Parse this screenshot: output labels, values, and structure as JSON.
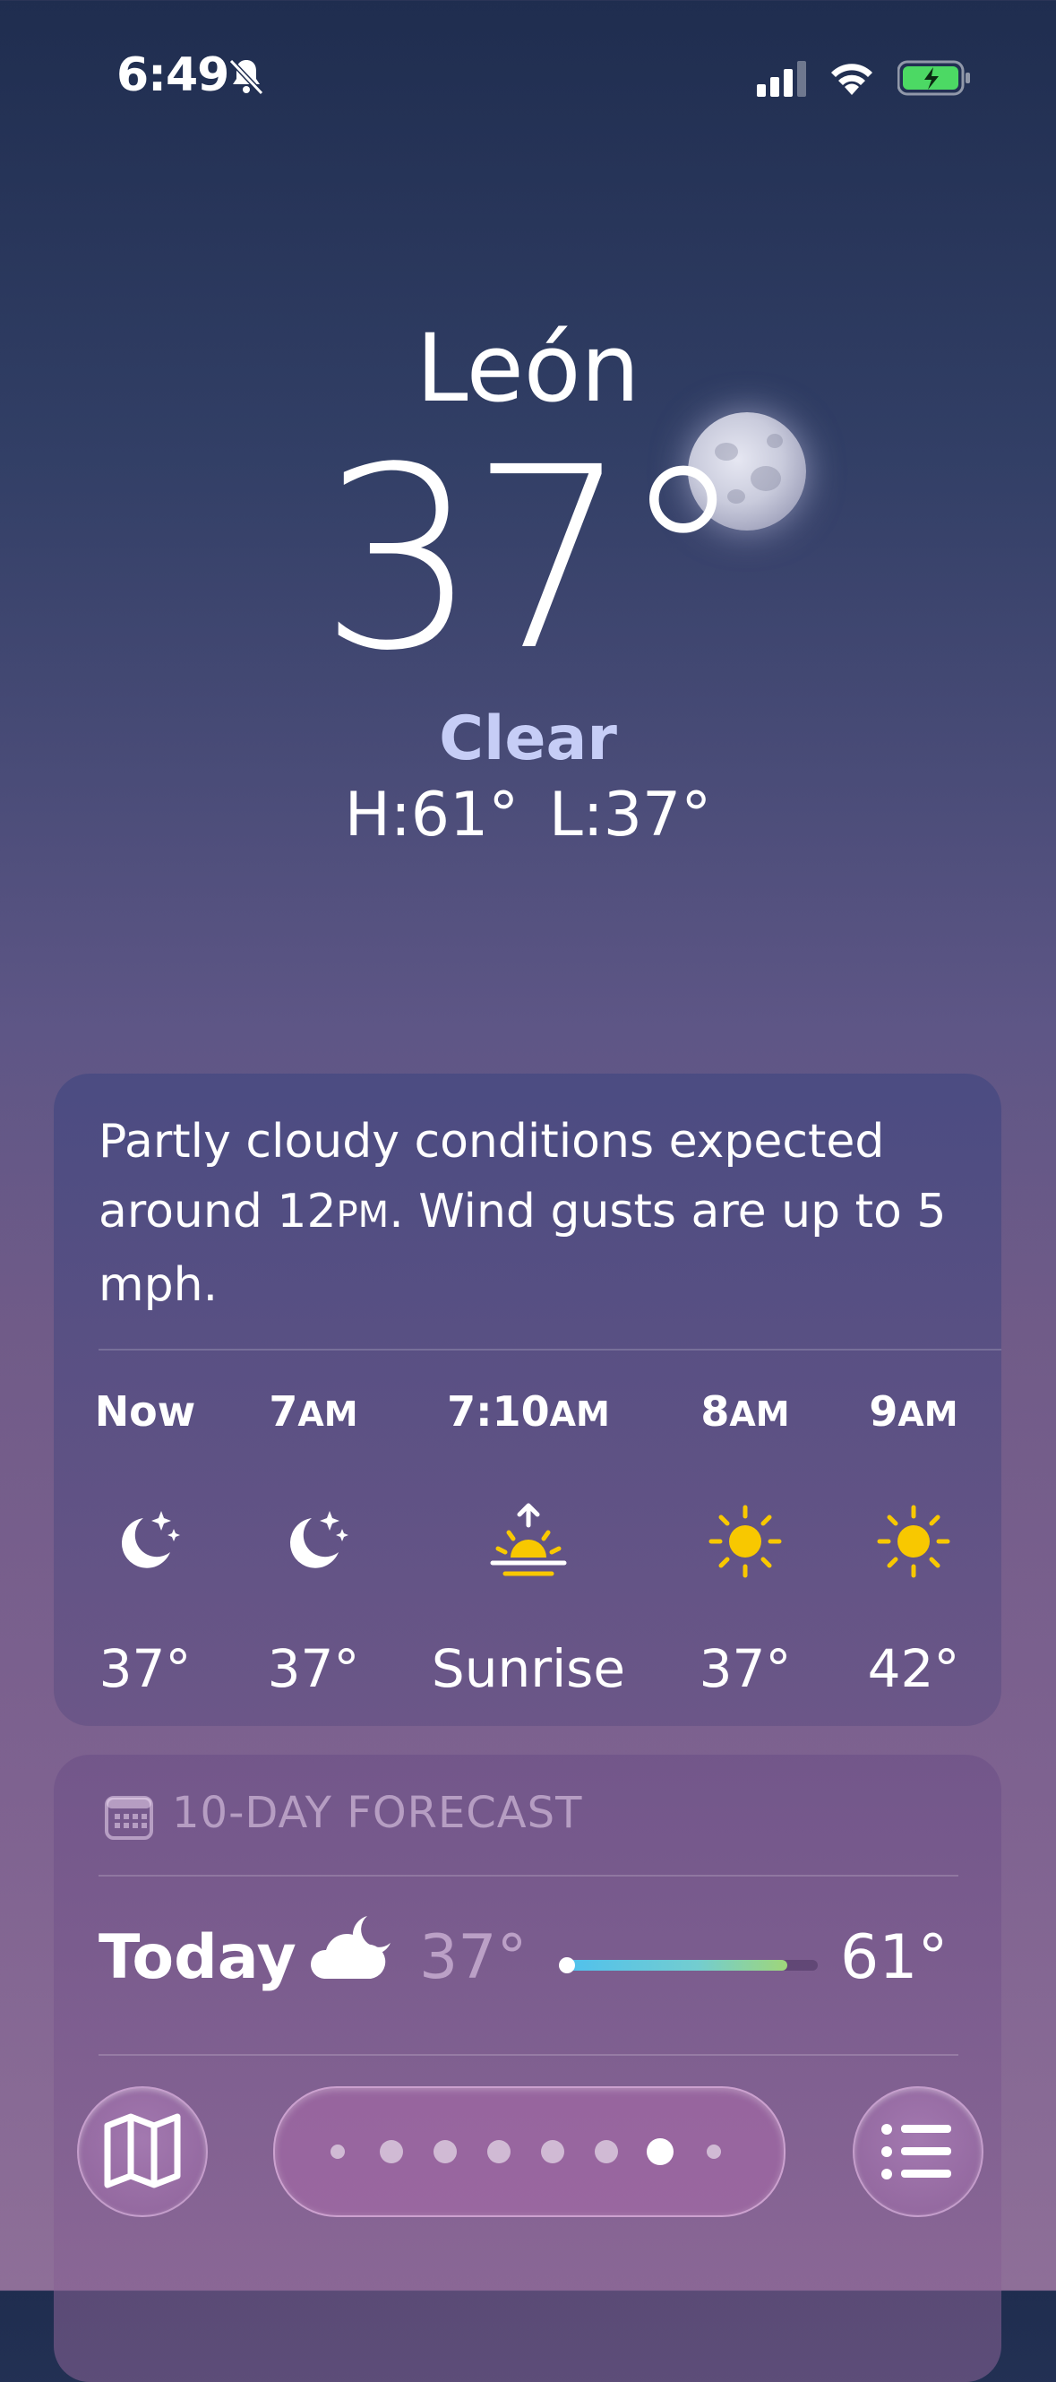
{
  "status_bar": {
    "time": "6:49",
    "bell_icon": "bell-slash-icon",
    "signal_icon": "cellular-signal-icon",
    "wifi_icon": "wifi-icon",
    "battery_icon": "battery-charging-icon",
    "battery_color": "#4cd964"
  },
  "current": {
    "city": "León",
    "temperature": "37°",
    "condition": "Clear",
    "high_low": "H:61°  L:37°",
    "condition_color": "#c6cdf6"
  },
  "hourly": {
    "summary_before": "Partly cloudy conditions expected around 12",
    "summary_pm": "PM",
    "summary_after": ". Wind gusts are up to 5 mph.",
    "hours": [
      {
        "label_main": "Now",
        "label_suffix": "",
        "icon": "moon-stars-icon",
        "temp": "37°"
      },
      {
        "label_main": "7",
        "label_suffix": "AM",
        "icon": "moon-stars-icon",
        "temp": "37°"
      },
      {
        "label_main": "7:10",
        "label_suffix": "AM",
        "icon": "sunrise-icon",
        "temp": "Sunrise"
      },
      {
        "label_main": "8",
        "label_suffix": "AM",
        "icon": "sun-icon",
        "temp": "37°"
      },
      {
        "label_main": "9",
        "label_suffix": "AM",
        "icon": "sun-icon",
        "temp": "42°"
      }
    ]
  },
  "forecast": {
    "title": "10-DAY FORECAST",
    "title_icon": "calendar-icon",
    "today": {
      "day": "Today",
      "icon": "cloud-moon-icon",
      "low": "37°",
      "high": "61°",
      "range_start_fraction": 0.0,
      "range_end_fraction": 0.88,
      "current_fraction": 0.0
    }
  },
  "bottom_bar": {
    "map_icon": "map-icon",
    "list_icon": "list-icon",
    "pages": 8,
    "active_page": 6
  }
}
